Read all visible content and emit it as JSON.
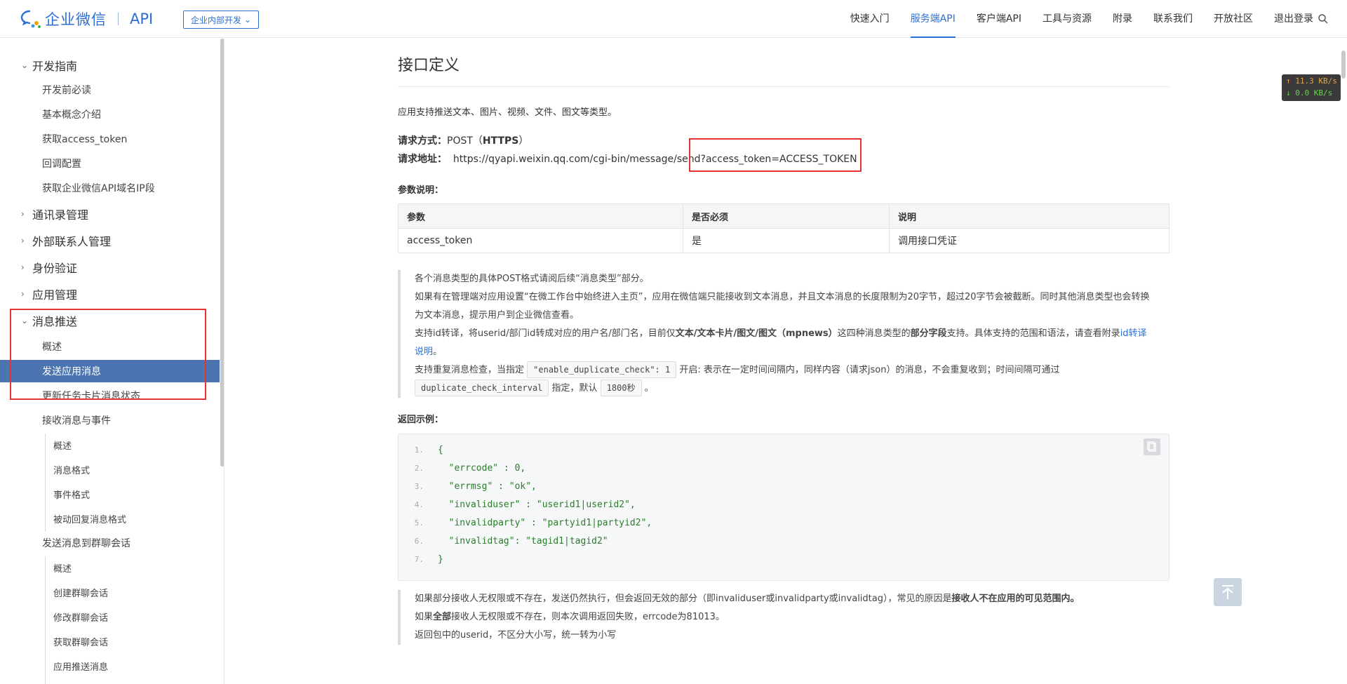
{
  "header": {
    "logo_text": "企业微信",
    "logo_api": "API",
    "mode_select": "企业内部开发",
    "nav": [
      "快速入门",
      "服务端API",
      "客户端API",
      "工具与资源",
      "附录",
      "联系我们",
      "开放社区",
      "退出登录"
    ],
    "active_nav": "服务端API"
  },
  "sidebar": {
    "items": [
      {
        "label": "开发指南",
        "level": 1,
        "expanded": true
      },
      {
        "label": "开发前必读",
        "level": 2
      },
      {
        "label": "基本概念介绍",
        "level": 2
      },
      {
        "label": "获取access_token",
        "level": 2
      },
      {
        "label": "回调配置",
        "level": 2
      },
      {
        "label": "获取企业微信API域名IP段",
        "level": 2
      },
      {
        "label": "通讯录管理",
        "level": 1,
        "expanded": false
      },
      {
        "label": "外部联系人管理",
        "level": 1,
        "expanded": false
      },
      {
        "label": "身份验证",
        "level": 1,
        "expanded": false
      },
      {
        "label": "应用管理",
        "level": 1,
        "expanded": false
      },
      {
        "label": "消息推送",
        "level": 1,
        "expanded": true
      },
      {
        "label": "概述",
        "level": 2
      },
      {
        "label": "发送应用消息",
        "level": 2,
        "active": true
      },
      {
        "label": "更新任务卡片消息状态",
        "level": 2
      },
      {
        "label": "接收消息与事件",
        "level": 2
      },
      {
        "label": "概述",
        "level": 3
      },
      {
        "label": "消息格式",
        "level": 3
      },
      {
        "label": "事件格式",
        "level": 3
      },
      {
        "label": "被动回复消息格式",
        "level": 3
      },
      {
        "label": "发送消息到群聊会话",
        "level": 2
      },
      {
        "label": "概述",
        "level": 3
      },
      {
        "label": "创建群聊会话",
        "level": 3
      },
      {
        "label": "修改群聊会话",
        "level": 3
      },
      {
        "label": "获取群聊会话",
        "level": 3
      },
      {
        "label": "应用推送消息",
        "level": 3
      }
    ]
  },
  "content": {
    "title": "接口定义",
    "intro": "应用支持推送文本、图片、视频、文件、图文等类型。",
    "method_label": "请求方式：",
    "method_value": "POST（",
    "method_https": "HTTPS",
    "method_close": "）",
    "url_label": "请求地址：",
    "url_value": "https://qyapi.weixin.qq.com/cgi-bin/message/send?access_token=ACCESS_TOKEN",
    "params_label": "参数说明：",
    "params_table": {
      "headers": [
        "参数",
        "是否必须",
        "说明"
      ],
      "rows": [
        [
          "access_token",
          "是",
          "调用接口凭证"
        ]
      ]
    },
    "notes": {
      "n1": "各个消息类型的具体POST格式请阅后续“消息类型”部分。",
      "n2": "如果有在管理端对应用设置“在微工作台中始终进入主页”，应用在微信端只能接收到文本消息，并且文本消息的长度限制为20字节，超过20字节会被截断。同时其他消息类型也会转换为文本消息，提示用户到企业微信查看。",
      "n3a": "支持id转译，将userid/部门id转成对应的用户名/部门名，目前仅",
      "n3b": "文本/文本卡片/图文/图文（mpnews）",
      "n3c": "这四种消息类型的",
      "n3d": "部分字段",
      "n3e": "支持。具体支持的范围和语法，请查看附录",
      "n3link": "id转译说明",
      "n3f": "。",
      "n4a": "支持重复消息检查，当指定",
      "n4code1": "\"enable_duplicate_check\": 1",
      "n4b": "开启: 表示在一定时间间隔内，同样内容（请求json）的消息，不会重复收到；时间间隔可通过",
      "n4code2": "duplicate_check_interval",
      "n4c": "指定，默认",
      "n4code3": "1800秒",
      "n4d": "。"
    },
    "return_label": "返回示例：",
    "code_lines": [
      {
        "n": "1.",
        "t": "{"
      },
      {
        "n": "2.",
        "t": "  \"errcode\" : 0,"
      },
      {
        "n": "3.",
        "t": "  \"errmsg\" : \"ok\","
      },
      {
        "n": "4.",
        "t": "  \"invaliduser\" : \"userid1|userid2\","
      },
      {
        "n": "5.",
        "t": "  \"invalidparty\" : \"partyid1|partyid2\","
      },
      {
        "n": "6.",
        "t": "  \"invalidtag\": \"tagid1|tagid2\""
      },
      {
        "n": "7.",
        "t": "}"
      }
    ],
    "notes2": {
      "m1a": "如果部分接收人无权限或不存在，发送仍然执行，但会返回无效的部分（即invaliduser或invalidparty或invalidtag），常见的原因是",
      "m1b": "接收人不在应用的可见范围内。",
      "m2a": "如果",
      "m2b": "全部",
      "m2c": "接收人无权限或不存在，则本次调用返回失败，errcode为81013。",
      "m3": "返回包中的userid，不区分大小写，统一转为小写"
    }
  },
  "net_widget": {
    "up": "↑ 11.3 KB/s",
    "down": "↓ 0.0 KB/s"
  },
  "colors": {
    "accent": "#2b6fd6",
    "active_bg": "#4b74b1",
    "highlight": "#e53333"
  }
}
